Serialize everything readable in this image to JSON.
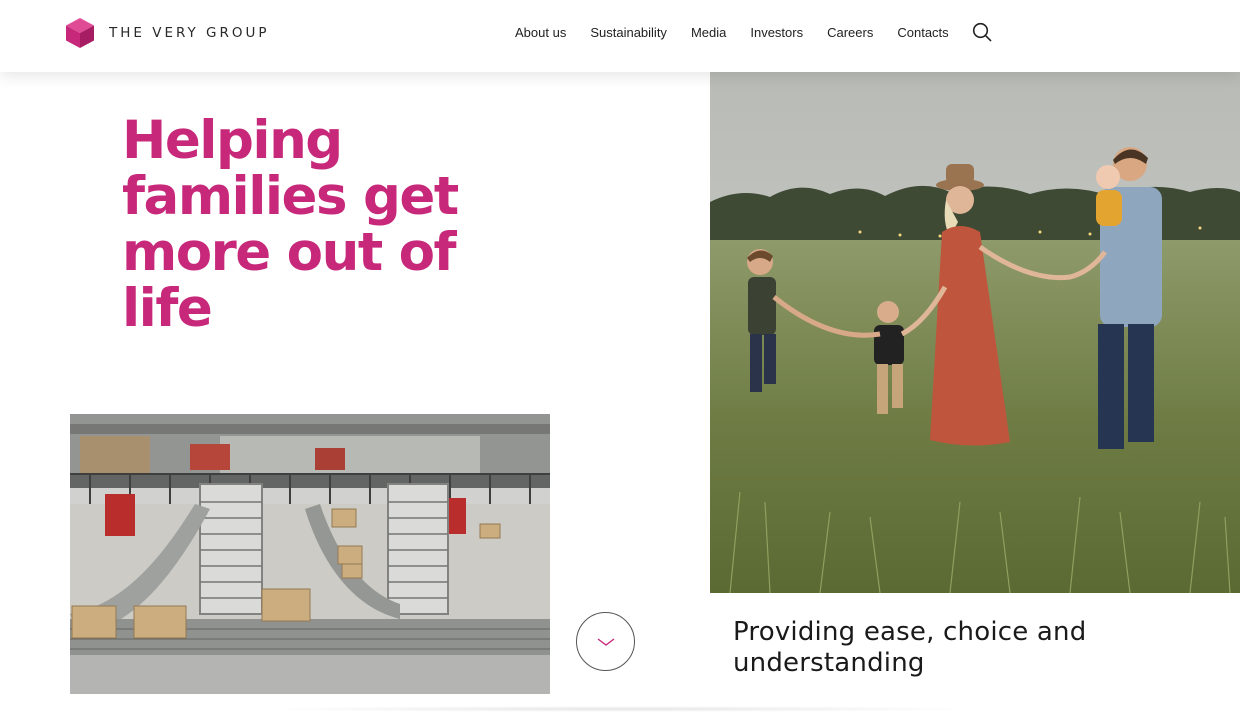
{
  "brand": {
    "name": "THE VERY GROUP",
    "color": "#c7287a"
  },
  "nav": {
    "items": [
      {
        "label": "About us"
      },
      {
        "label": "Sustainability"
      },
      {
        "label": "Media"
      },
      {
        "label": "Investors"
      },
      {
        "label": "Careers"
      },
      {
        "label": "Contacts"
      }
    ],
    "search_icon": "search-icon"
  },
  "hero": {
    "headline": "Helping families get more out of life",
    "tagline": "Providing ease, choice and understanding"
  },
  "images": {
    "warehouse": "warehouse-conveyor-photo",
    "family": "family-walking-field-photo"
  },
  "scroll_icon": "chevron-down-icon"
}
